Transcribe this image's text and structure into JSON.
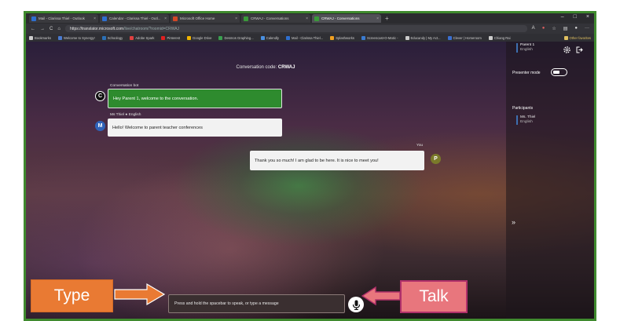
{
  "browser": {
    "tabs": [
      {
        "label": "Mail - Clarissa Thiel - Outlook",
        "color": "#2e6fd0",
        "active": false
      },
      {
        "label": "Calendar - Clarissa Thiel - Outl...",
        "color": "#2e6fd0",
        "active": false
      },
      {
        "label": "Microsoft Office Home",
        "color": "#d24726",
        "active": false
      },
      {
        "label": "CRWAJ - Conversations",
        "color": "#3a9a3a",
        "active": false
      },
      {
        "label": "CRWAJ - Conversations",
        "color": "#3a9a3a",
        "active": true
      }
    ],
    "tab_close": "×",
    "new_tab": "+",
    "window_controls": [
      "–",
      "□",
      "×"
    ],
    "nav": {
      "back": "←",
      "forward": "→",
      "reload": "C",
      "home": "⌂"
    },
    "url_host": "https://translator.microsoft.com",
    "url_path": "/live/chatroom/?roomid=CRWAJ",
    "bookmarks": [
      {
        "label": "Bookmarks",
        "color": "#cccccc"
      },
      {
        "label": "Welcome to Synergy!",
        "color": "#4a7bd0"
      },
      {
        "label": "Schoology",
        "color": "#2b6fb5"
      },
      {
        "label": "Adobe Spark",
        "color": "#e04040"
      },
      {
        "label": "Pinterest",
        "color": "#e02020"
      },
      {
        "label": "Google Drive",
        "color": "#f0b400"
      },
      {
        "label": "Desmos Graphing...",
        "color": "#3aa050"
      },
      {
        "label": "Calendly",
        "color": "#4a90e0"
      },
      {
        "label": "Mail - Clarissa Thiel...",
        "color": "#2e6fd0"
      },
      {
        "label": "Splashworks",
        "color": "#f0a020"
      },
      {
        "label": "Screencast-O-Matic -",
        "color": "#3a7bd0"
      },
      {
        "label": "Educandy | My Act...",
        "color": "#cccccc"
      },
      {
        "label": "Clever | Homeroom",
        "color": "#3a6fd0"
      },
      {
        "label": "Chiang Rai",
        "color": "#cccccc"
      }
    ],
    "other_favorites": "Other favorites"
  },
  "conversation": {
    "code_label": "Conversation code:",
    "code": "CRWAJ",
    "messages": [
      {
        "sender": "Conversation bot",
        "initial": "C",
        "text": "Hey Parent 1, welcome to the conversation."
      },
      {
        "sender": "Ms Thiel",
        "language": "English",
        "initial": "M",
        "text": "Hello! Welcome to parent teacher conferences"
      },
      {
        "sender": "You",
        "initial": "P",
        "text": "Thank you so much! I am glad to be here. It is nice to meet you!"
      }
    ],
    "input_placeholder": "Press and hold the spacebar to speak, or type a message"
  },
  "sidebar": {
    "user_name": "Parent 1",
    "user_language": "English",
    "presenter_mode": "Presenter mode",
    "participants_title": "Participants",
    "participants": [
      {
        "name": "Ms. Thiel",
        "language": "English"
      }
    ],
    "expand_glyph": "»"
  },
  "callouts": {
    "type": "Type",
    "talk": "Talk"
  },
  "colors": {
    "bot_bubble": "#2e8b2e",
    "self_avatar": "#7a7a2a",
    "teacher_avatar": "#2f63b8",
    "type_callout": "#e97a33",
    "talk_callout": "#e8767d"
  }
}
